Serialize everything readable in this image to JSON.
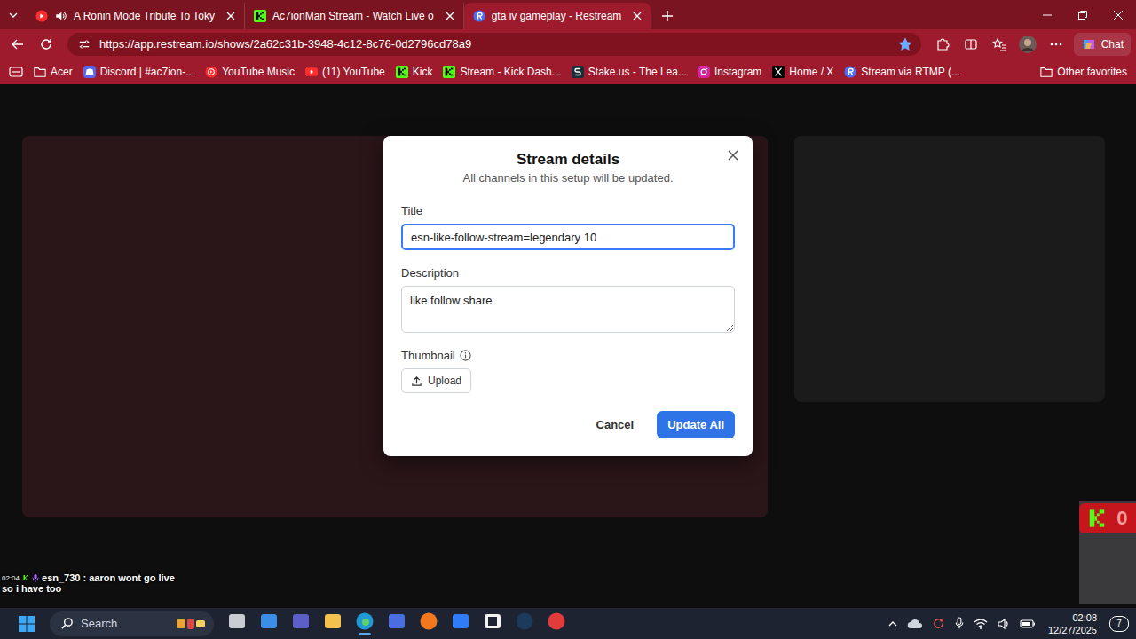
{
  "browser": {
    "tabs": [
      {
        "label": "A Ronin Mode Tribute To Toky",
        "selected": false,
        "kind": "youtube",
        "audio": true
      },
      {
        "label": "Ac7ionMan Stream - Watch Live o",
        "selected": false,
        "kind": "kick",
        "audio": false
      },
      {
        "label": "gta iv gameplay - Restream",
        "selected": true,
        "kind": "restream",
        "audio": false
      }
    ],
    "address": "https://app.restream.io/shows/2a62c31b-3948-4c12-8c76-0d2796cd78a9",
    "favorite": true,
    "chat_button": "Chat",
    "bookmarks": [
      {
        "label": "Acer",
        "kind": "folder"
      },
      {
        "label": "Discord | #ac7ion-...",
        "kind": "discord"
      },
      {
        "label": "YouTube Music",
        "kind": "ytmusic"
      },
      {
        "label": "(11) YouTube",
        "kind": "youtube"
      },
      {
        "label": "Kick",
        "kind": "kick"
      },
      {
        "label": "Stream - Kick Dash...",
        "kind": "kick"
      },
      {
        "label": "Stake.us - The Lea...",
        "kind": "stake"
      },
      {
        "label": "Instagram",
        "kind": "instagram"
      },
      {
        "label": "Home / X",
        "kind": "x"
      },
      {
        "label": "Stream via RTMP (...",
        "kind": "restream"
      }
    ],
    "other_favorites": "Other favorites"
  },
  "dialog": {
    "title": "Stream details",
    "subtitle": "All channels in this setup will be updated.",
    "fields": [
      {
        "label": "Title",
        "value": "esn-like-follow-stream=legendary 10",
        "focused": true,
        "kind": "input"
      },
      {
        "label": "Description",
        "value": "like follow share",
        "focused": false,
        "kind": "textarea"
      }
    ],
    "thumbnail": {
      "label": "Thumbnail",
      "button": "Upload"
    },
    "buttons": [
      {
        "label": "Cancel",
        "primary": false
      },
      {
        "label": "Update All",
        "primary": true
      }
    ]
  },
  "stream_overlay": {
    "chat": {
      "time": "02:04",
      "user": "esn_730",
      "message": " : aaron wont go live",
      "line2": "so i have too"
    },
    "kick_count": "0"
  },
  "taskbar": {
    "search": "Search",
    "apps": [
      {
        "kind": "taskview",
        "active": false
      },
      {
        "kind": "widgets",
        "active": false
      },
      {
        "kind": "meet",
        "active": false
      },
      {
        "kind": "explorer",
        "active": false
      },
      {
        "kind": "edge",
        "active": true
      },
      {
        "kind": "store",
        "active": false
      },
      {
        "kind": "firefox",
        "active": false
      },
      {
        "kind": "dropbox",
        "active": false
      },
      {
        "kind": "notion",
        "active": false
      },
      {
        "kind": "steam",
        "active": false
      },
      {
        "kind": "recorder",
        "active": false
      }
    ],
    "time": "02:08",
    "date": "12/27/2025",
    "notifications": "7"
  }
}
